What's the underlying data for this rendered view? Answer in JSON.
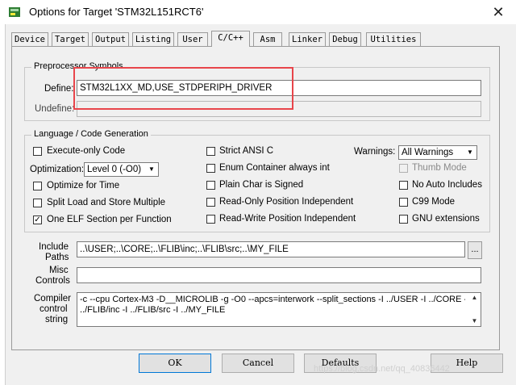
{
  "window": {
    "title": "Options for Target 'STM32L151RCT6'",
    "close_glyph": "✕"
  },
  "tabs": [
    "Device",
    "Target",
    "Output",
    "Listing",
    "User",
    "C/C++",
    "Asm",
    "Linker",
    "Debug",
    "Utilities"
  ],
  "active_tab": "C/C++",
  "preprocessor": {
    "group_label": "Preprocessor Symbols",
    "define_label": "Define:",
    "define_value": "STM32L1XX_MD,USE_STDPERIPH_DRIVER",
    "undefine_label": "Undefine:",
    "undefine_value": ""
  },
  "language": {
    "group_label": "Language / Code Generation",
    "execute_only": {
      "label": "Execute-only Code",
      "checked": false
    },
    "optimization_label": "Optimization:",
    "optimization_value": "Level 0 (-O0)",
    "optimize_time": {
      "label": "Optimize for Time",
      "checked": false
    },
    "split_load": {
      "label": "Split Load and Store Multiple",
      "checked": false
    },
    "one_elf": {
      "label": "One ELF Section per Function",
      "checked": true
    },
    "strict_ansi": {
      "label": "Strict ANSI C",
      "checked": false
    },
    "enum_container": {
      "label": "Enum Container always int",
      "checked": false
    },
    "plain_char": {
      "label": "Plain Char is Signed",
      "checked": false
    },
    "ro_pi": {
      "label": "Read-Only Position Independent",
      "checked": false
    },
    "rw_pi": {
      "label": "Read-Write Position Independent",
      "checked": false
    },
    "warnings_label": "Warnings:",
    "warnings_value": "All Warnings",
    "thumb_mode": {
      "label": "Thumb Mode",
      "checked": false,
      "disabled": true
    },
    "no_auto_includes": {
      "label": "No Auto Includes",
      "checked": false
    },
    "c99_mode": {
      "label": "C99 Mode",
      "checked": false
    },
    "gnu_extensions": {
      "label": "GNU extensions",
      "checked": false
    }
  },
  "include_paths": {
    "label_line1": "Include",
    "label_line2": "Paths",
    "value": "..\\USER;..\\CORE;..\\FLIB\\inc;..\\FLIB\\src;..\\MY_FILE",
    "browse_label": "..."
  },
  "misc_controls": {
    "label_line1": "Misc",
    "label_line2": "Controls",
    "value": ""
  },
  "compiler_control": {
    "label_line1": "Compiler",
    "label_line2": "control",
    "label_line3": "string",
    "line1": "-c --cpu Cortex-M3 -D__MICROLIB -g -O0 --apcs=interwork --split_sections -I ../USER -I ../CORE -I",
    "line2": "../FLIB/inc -I ../FLIB/src -I ../MY_FILE"
  },
  "buttons": {
    "ok": "OK",
    "cancel": "Cancel",
    "defaults": "Defaults",
    "help": "Help"
  },
  "watermark": "https://blog.csdn.net/qq_40836442",
  "colors": {
    "highlight_box": "#e8454b",
    "default_button_border": "#0078d7"
  }
}
